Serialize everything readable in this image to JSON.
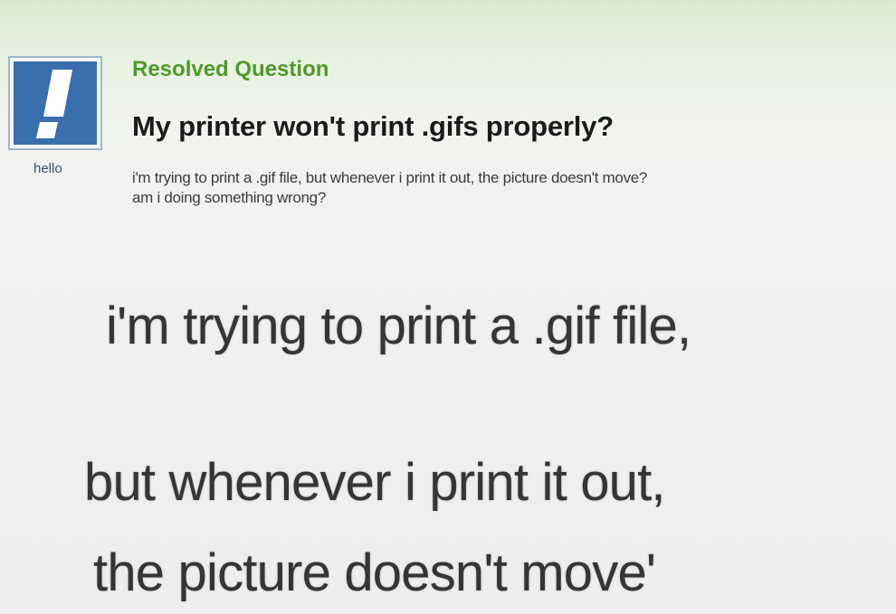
{
  "question": {
    "avatar": {
      "icon": "exclamation-icon",
      "bg_color": "#3a6fae"
    },
    "username": "hello",
    "status": "Resolved Question",
    "title": "My printer won't print .gifs properly?",
    "details": [
      "i'm trying to print a .gif file, but whenever i print it out, the picture doesn't move?",
      "am i doing something wrong?"
    ]
  },
  "zoom_caption": {
    "lines": [
      "i'm trying to print a .gif file,",
      "but whenever i print it out,",
      "the picture doesn't move'"
    ]
  },
  "colors": {
    "status_green": "#4f9a2a",
    "title_text": "#1b1b1b",
    "avatar_blue": "#3a6fae"
  }
}
